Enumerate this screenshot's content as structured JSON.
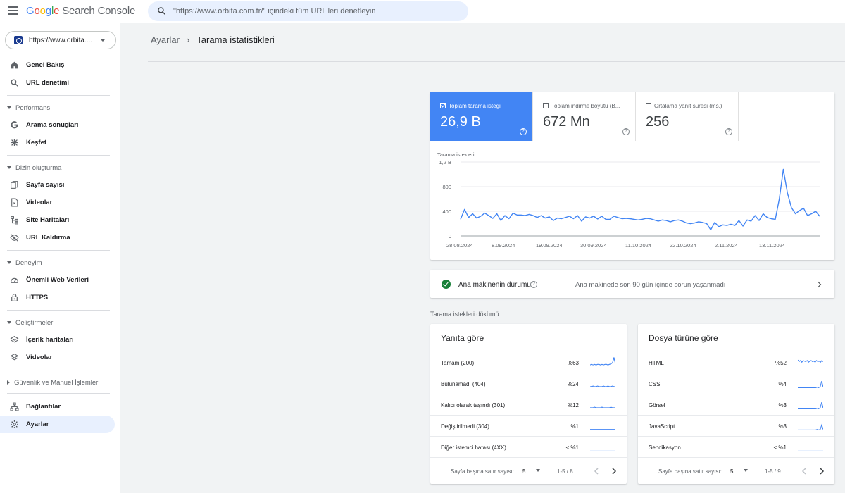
{
  "app": {
    "brand_google": [
      "G",
      "o",
      "o",
      "g",
      "l",
      "e"
    ],
    "brand_product": "Search Console"
  },
  "search": {
    "placeholder": "\"https://www.orbita.com.tr/\" içindeki tüm URL'leri denetleyin"
  },
  "property": {
    "label": "https://www.orbita...."
  },
  "sidebar": {
    "items": [
      {
        "label": "Genel Bakış",
        "icon": "home-icon"
      },
      {
        "label": "URL denetimi",
        "icon": "search-icon"
      },
      {
        "section": "Performans"
      },
      {
        "label": "Arama sonuçları",
        "icon": "google-g-icon"
      },
      {
        "label": "Keşfet",
        "icon": "asterisk-icon"
      },
      {
        "section": "Dizin oluşturma"
      },
      {
        "label": "Sayfa sayısı",
        "icon": "pages-icon"
      },
      {
        "label": "Videolar",
        "icon": "video-page-icon"
      },
      {
        "label": "Site Haritaları",
        "icon": "sitemap-icon"
      },
      {
        "label": "URL Kaldırma",
        "icon": "eye-off-icon"
      },
      {
        "section": "Deneyim"
      },
      {
        "label": "Önemli Web Verileri",
        "icon": "speed-icon"
      },
      {
        "label": "HTTPS",
        "icon": "lock-icon"
      },
      {
        "section": "Geliştirmeler"
      },
      {
        "label": "İçerik haritaları",
        "icon": "layers-icon"
      },
      {
        "label": "Videolar",
        "icon": "layers-icon"
      },
      {
        "section": "Güvenlik ve Manuel İşlemler"
      },
      {
        "label": "Bağlantılar",
        "icon": "links-icon"
      },
      {
        "label": "Ayarlar",
        "icon": "gear-icon",
        "active": true
      }
    ]
  },
  "breadcrumb": {
    "parent": "Ayarlar",
    "current": "Tarama istatistikleri"
  },
  "metrics": [
    {
      "label": "Toplam tarama isteği",
      "value": "26,9 B",
      "checked": true
    },
    {
      "label": "Toplam indirme boyutu (B...",
      "value": "672 Mn",
      "checked": false
    },
    {
      "label": "Ortalama yanıt süresi (ms.)",
      "value": "256",
      "checked": false
    }
  ],
  "chart_data": {
    "type": "line",
    "title": "Tarama istekleri",
    "yticks": [
      "1,2 B",
      "800",
      "400",
      "0"
    ],
    "ylim": [
      0,
      1200
    ],
    "xticks": [
      "28.08.2024",
      "8.09.2024",
      "19.09.2024",
      "30.09.2024",
      "11.10.2024",
      "22.10.2024",
      "2.11.2024",
      "13.11.2024"
    ],
    "color": "#4285f4",
    "series": [
      {
        "values": [
          270,
          430,
          300,
          360,
          290,
          320,
          370,
          330,
          285,
          360,
          250,
          330,
          280,
          370,
          340,
          340,
          330,
          350,
          330,
          300,
          330,
          290,
          310,
          250,
          290,
          280,
          300,
          320,
          280,
          330,
          240,
          310,
          290,
          320,
          275,
          320,
          270,
          270,
          320,
          300,
          280,
          285,
          280,
          270,
          260,
          270,
          285,
          280,
          260,
          240,
          260,
          250,
          230,
          250,
          260,
          240,
          210,
          200,
          210,
          230,
          220,
          200,
          100,
          220,
          150,
          180,
          170,
          190,
          170,
          250,
          160,
          260,
          240,
          330,
          250,
          360,
          300,
          280,
          270,
          600,
          1080,
          700,
          460,
          360,
          410,
          450,
          330,
          360,
          400,
          320
        ]
      }
    ]
  },
  "host_status": {
    "title": "Ana makinenin durumu",
    "message": "Ana makinede son 90 gün içinde sorun yaşanmadı"
  },
  "breakdown_label": "Tarama istekleri dökümü",
  "breakdowns": [
    {
      "title": "Yanıta göre",
      "rows": [
        {
          "label": "Tamam (200)",
          "value": "%63",
          "spark": [
            5,
            6,
            5,
            6,
            5,
            6,
            6,
            5,
            6,
            5,
            6,
            6,
            5,
            6,
            7,
            9,
            18,
            7
          ]
        },
        {
          "label": "Bulunamadı (404)",
          "value": "%24",
          "spark": [
            4,
            4,
            5,
            4,
            4,
            5,
            4,
            4,
            4,
            5,
            4,
            4,
            5,
            4,
            4,
            5,
            4,
            4
          ]
        },
        {
          "label": "Kalıcı olarak taşındı (301)",
          "value": "%12",
          "spark": [
            4,
            4,
            4,
            5,
            4,
            4,
            4,
            4,
            5,
            4,
            4,
            4,
            4,
            4,
            5,
            4,
            4,
            4
          ]
        },
        {
          "label": "Değiştirilmedi (304)",
          "value": "%1",
          "spark": [
            3,
            3,
            3,
            3,
            3,
            3,
            3,
            3,
            3,
            3,
            3,
            3,
            3,
            3,
            3,
            3,
            3,
            3
          ]
        },
        {
          "label": "Diğer istemci hatası (4XX)",
          "value": "< %1",
          "spark": [
            2,
            2,
            2,
            2,
            2,
            2,
            2,
            2,
            2,
            2,
            2,
            2,
            2,
            2,
            2,
            2,
            2,
            2
          ]
        }
      ],
      "rows_per_page_label": "Sayfa başına satır sayısı:",
      "rows_per_page": "5",
      "range": "1-5 / 8"
    },
    {
      "title": "Dosya türüne göre",
      "rows": [
        {
          "label": "HTML",
          "value": "%52",
          "spark": [
            14,
            11,
            13,
            10,
            13,
            12,
            11,
            13,
            10,
            12,
            13,
            11,
            12,
            10,
            13,
            11,
            12,
            10,
            13,
            11
          ]
        },
        {
          "label": "CSS",
          "value": "%4",
          "spark": [
            2,
            2,
            2,
            2,
            2,
            2,
            2,
            2,
            2,
            2,
            2,
            2,
            2,
            3,
            2,
            4,
            14,
            3
          ]
        },
        {
          "label": "Görsel",
          "value": "%3",
          "spark": [
            2,
            2,
            2,
            2,
            2,
            2,
            2,
            2,
            2,
            2,
            2,
            2,
            2,
            3,
            2,
            4,
            14,
            3
          ]
        },
        {
          "label": "JavaScript",
          "value": "%3",
          "spark": [
            2,
            2,
            2,
            2,
            2,
            2,
            2,
            2,
            2,
            2,
            2,
            2,
            2,
            3,
            2,
            3,
            11,
            3
          ]
        },
        {
          "label": "Sendikasyon",
          "value": "< %1",
          "spark": [
            2,
            2,
            2,
            2,
            2,
            2,
            2,
            2,
            2,
            2,
            2,
            2,
            2,
            2,
            2,
            2,
            2,
            2
          ]
        }
      ],
      "rows_per_page_label": "Sayfa başına satır sayısı:",
      "rows_per_page": "5",
      "range": "1-5 / 9"
    }
  ]
}
